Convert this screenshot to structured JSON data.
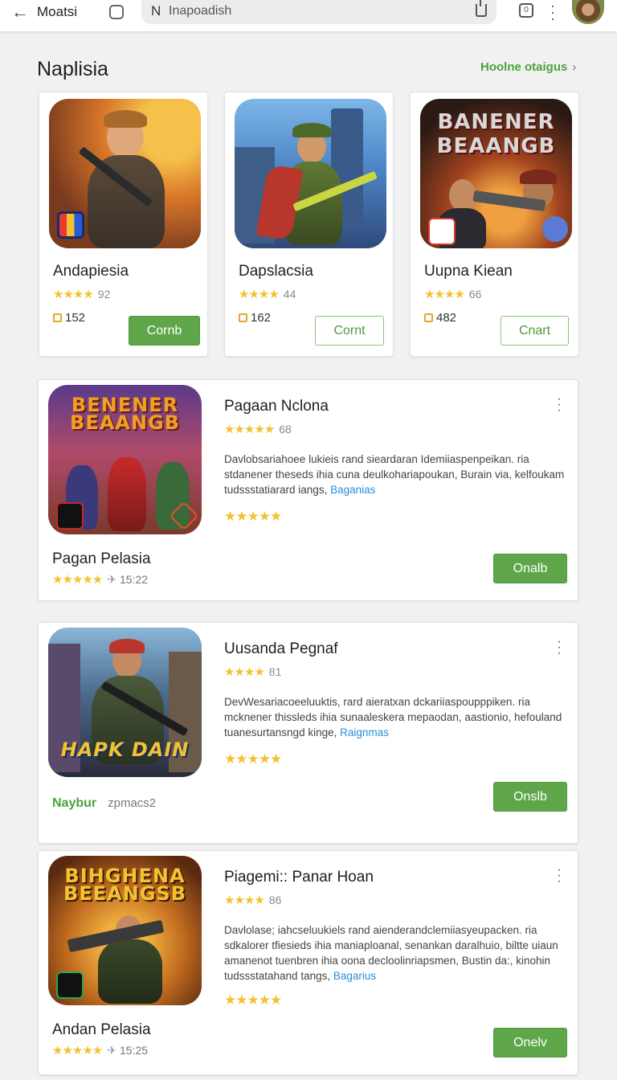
{
  "topbar": {
    "back_icon": "arrow-left-icon",
    "title": "Moatsi",
    "search_prefix": "N",
    "search_text": "Inapoadish"
  },
  "section": {
    "title": "Naplisia",
    "link": "Hoolne otaigus",
    "link_chevron": "›"
  },
  "top_cards": [
    {
      "name": "Andapiesia",
      "stars": "★★★★",
      "rating": "92",
      "downloads": "152",
      "button": "Cornb",
      "button_style": "filled"
    },
    {
      "name": "Dapslacsia",
      "stars": "★★★★",
      "rating": "44",
      "downloads": "162",
      "button": "Cornt",
      "button_style": "outline"
    },
    {
      "name": "Uupna Kiean",
      "stars": "★★★★",
      "rating": "66",
      "downloads": "482",
      "button": "Cnart",
      "button_style": "outline"
    }
  ],
  "list_cards": [
    {
      "art_title": "BENENER BEAANGB",
      "title": "Pagaan Nclona",
      "stars": "★★★★★",
      "rating": "68",
      "desc": "Davlobsariahoee lukieis rand sieardaran Idemiiaspenpeikan.    ria stdanener theseds ihia cuna deulkohariapoukan, Burain via, kelfoukam tudssstatiarard iangs,",
      "desc_link": "Baganias",
      "stars2": "★★★★★",
      "foot_name": "Pagan Pelasia",
      "foot_stars": "★★★★★",
      "foot_time": "15:22",
      "button": "Onalb"
    },
    {
      "art_title": "HAPK DAIN",
      "title": "Uusanda Pegnaf",
      "stars": "★★★★",
      "rating": "81",
      "desc": "DevWesariacoeeluuktis, rard aieratxan dckariiaspoupppiken.    ria mcknener thissleds ihia sunaaleskera mepaodan, aastionio, hefouland tuanesurtansngd kinge,",
      "desc_link": "Raignmas",
      "stars2": "★★★★★",
      "foot_green": "Naybur",
      "foot_grey": "zpmacs2",
      "button": "Onslb"
    },
    {
      "art_title": "BIHGHENA BEEANGSB",
      "title": "Piagemi:: Panar Hoan",
      "stars": "★★★★",
      "rating": "86",
      "desc": "Davlolase; iahcseluukiels rand aienderandclemiiasyeupacken.    ria sdkalorer tfiesieds ihia maniaploanal, senankan daralhuio, biltte uiaun amanenot tuenbren ihia oona decloolinriapsmen, Bustin da:, kinohin tudssstatahand tangs,",
      "desc_link": "Bagarius",
      "stars2": "★★★★★",
      "foot_name": "Andan Pelasia",
      "foot_stars": "★★★★★",
      "foot_time": "15:25",
      "button": "Onelv"
    }
  ],
  "colors": {
    "accent_green": "#5fa64a",
    "link_blue": "#2a8ed6",
    "star_yellow": "#f2c230"
  }
}
